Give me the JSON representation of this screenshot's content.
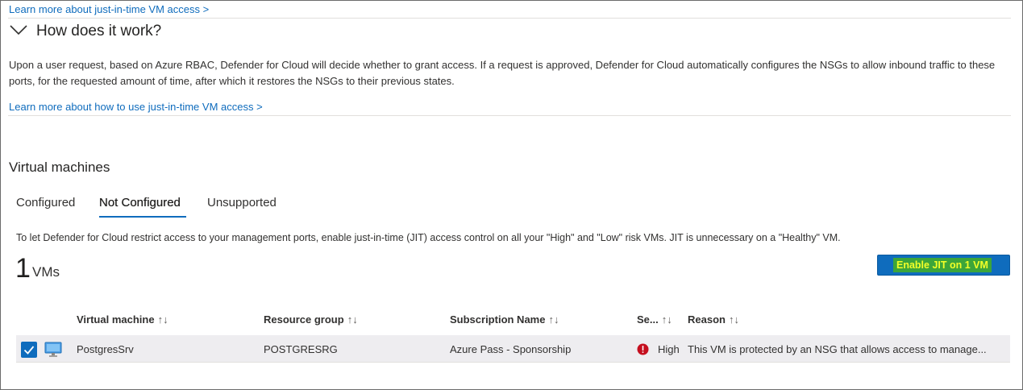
{
  "links": {
    "learn_jit": "Learn more about just-in-time VM access >",
    "learn_how": "Learn more about how to use just-in-time VM access >"
  },
  "how_section": {
    "title": "How does it work?",
    "description": "Upon a user request, based on Azure RBAC, Defender for Cloud will decide whether to grant access. If a request is approved, Defender for Cloud automatically configures the NSGs to allow inbound traffic to these ports, for the requested amount of time, after which it restores the NSGs to their previous states."
  },
  "vm_section": {
    "title": "Virtual machines",
    "tabs": [
      {
        "label": "Configured",
        "active": false
      },
      {
        "label": "Not Configured",
        "active": true
      },
      {
        "label": "Unsupported",
        "active": false
      }
    ],
    "info": "To let Defender for Cloud restrict access to your management ports, enable just-in-time (JIT) access control on all your \"High\" and \"Low\" risk VMs. JIT is unnecessary on a \"Healthy\" VM.",
    "count": "1",
    "count_unit": "VMs",
    "enable_button": "Enable JIT on 1 VM"
  },
  "table": {
    "columns": {
      "vm": "Virtual machine",
      "rg": "Resource group",
      "sub": "Subscription Name",
      "sev": "Se...",
      "reason": "Reason",
      "sort_glyph": "↑↓"
    },
    "rows": [
      {
        "vm": "PostgresSrv",
        "rg": "POSTGRESRG",
        "sub": "Azure Pass - Sponsorship",
        "sev": "High",
        "reason": "This VM is protected by an NSG that allows access to manage...",
        "checked": true
      }
    ]
  },
  "colors": {
    "accent": "#0f6cbd",
    "error": "#c50f1f",
    "highlight_bg": "#3ca53a",
    "highlight_text": "#f3ff28"
  },
  "icons": {
    "collapse": "chevron-down-icon",
    "checkbox": "checkmark-icon",
    "vm": "monitor-icon",
    "severity": "error-circle-icon"
  }
}
